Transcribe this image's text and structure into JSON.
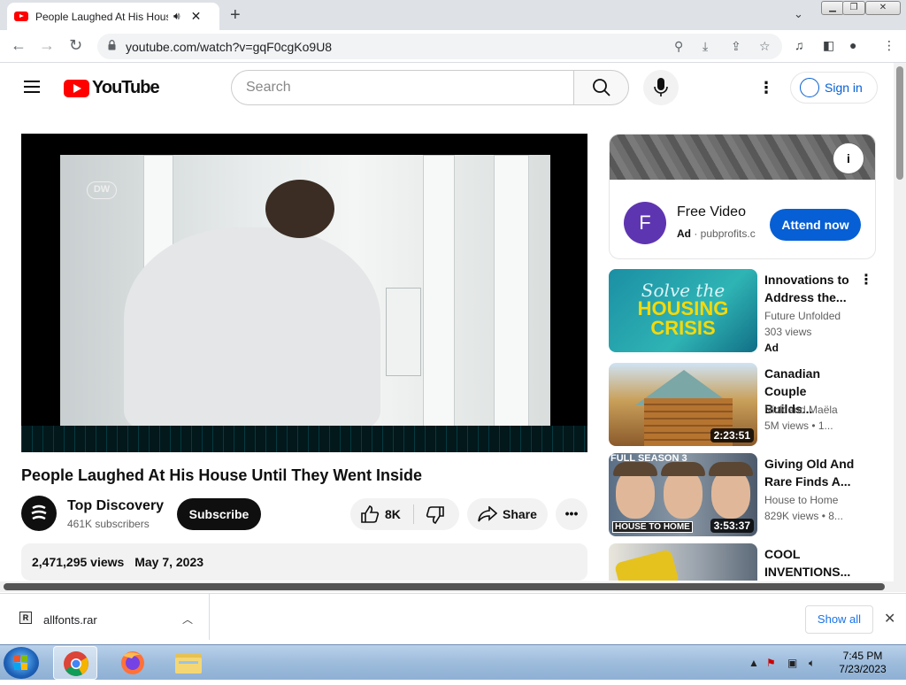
{
  "browser": {
    "tab_title": "People Laughed At His House Until They Went Inside",
    "url": "youtube.com/watch?v=gqF0cgKo9U8"
  },
  "yt": {
    "logo_text": "YouTube",
    "search_placeholder": "Search",
    "signin_label": "Sign in"
  },
  "video": {
    "title": "People Laughed At His House Until They Went Inside",
    "watermark": "DW",
    "channel_name": "Top Discovery",
    "subscribers": "461K subscribers",
    "subscribe_label": "Subscribe",
    "like_count": "8K",
    "share_label": "Share",
    "views": "2,471,295 views",
    "date": "May 7, 2023"
  },
  "ad": {
    "logo_letter": "F",
    "title": "Free Video",
    "ad_label": "Ad",
    "domain": "pubprofits.c",
    "cta": "Attend now"
  },
  "recommendations": [
    {
      "title": "Innovations to Address the...",
      "channel": "Future Unfolded",
      "meta": "303 views",
      "badge": "Ad",
      "thumb_text_1": "Solve the",
      "thumb_text_2": "HOUSING CRISIS"
    },
    {
      "title": "Canadian Couple Builds...",
      "channel": "Nick and Maëla",
      "meta": "5M views • 1...",
      "duration": "2:23:51"
    },
    {
      "title": "Giving Old And Rare Finds A...",
      "channel": "House to Home",
      "meta": "829K views • 8...",
      "duration": "3:53:37",
      "thumb_text": "FULL SEASON 3",
      "thumb_logo": "HOUSE TO HOME"
    },
    {
      "title": "COOL INVENTIONS..."
    }
  ],
  "download": {
    "file_icon": "R",
    "filename": "allfonts.rar",
    "show_all": "Show all"
  },
  "taskbar": {
    "time": "7:45 PM",
    "date": "7/23/2023"
  },
  "colors": {
    "yt_red": "#ff0000",
    "link_blue": "#065fd4",
    "ad_purple": "#5e35b1"
  }
}
